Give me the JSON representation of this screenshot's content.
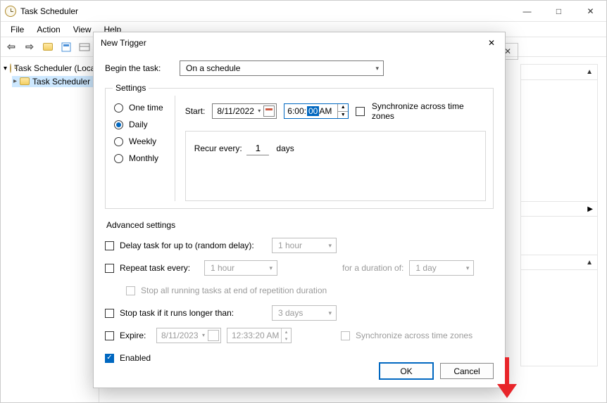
{
  "outer": {
    "title": "Task Scheduler",
    "menu": {
      "file": "File",
      "action": "Action",
      "view": "View",
      "help": "Help"
    },
    "tree": {
      "root": "Task Scheduler (Local)",
      "child": "Task Scheduler Library"
    },
    "inner_close": "✕"
  },
  "win": {
    "min": "—",
    "max": "□",
    "close": "✕"
  },
  "dialog": {
    "title": "New Trigger",
    "close": "✕",
    "begin_label": "Begin the task:",
    "begin_value": "On a schedule",
    "settings_legend": "Settings",
    "freq": {
      "one": "One time",
      "daily": "Daily",
      "weekly": "Weekly",
      "monthly": "Monthly"
    },
    "start_label": "Start:",
    "start_date": "8/11/2022",
    "start_hh": "6:00:",
    "start_mm": "00",
    "start_ampm": " AM",
    "sync_label": "Synchronize across time zones",
    "recur_label": "Recur every:",
    "recur_value": "1",
    "recur_unit": "days",
    "adv_title": "Advanced settings",
    "delay_label": "Delay task for up to (random delay):",
    "delay_val": "1 hour",
    "repeat_label": "Repeat task every:",
    "repeat_val": "1 hour",
    "duration_label": "for a duration of:",
    "duration_val": "1 day",
    "stop_running_label": "Stop all running tasks at end of repetition duration",
    "stop_if_label": "Stop task if it runs longer than:",
    "stop_if_val": "3 days",
    "expire_label": "Expire:",
    "expire_date": "8/11/2023",
    "expire_time": "12:33:20 AM",
    "sync2_label": "Synchronize across time zones",
    "enabled_label": "Enabled",
    "ok": "OK",
    "cancel": "Cancel"
  }
}
